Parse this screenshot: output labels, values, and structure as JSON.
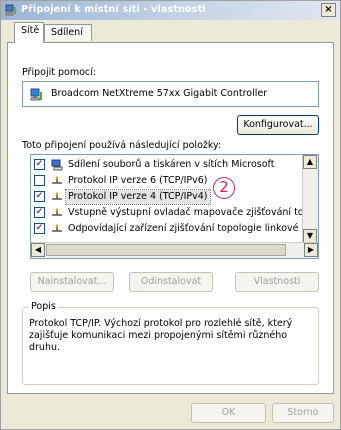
{
  "window": {
    "title": "Připojení k místní síti - vlastnosti",
    "close_glyph": "×",
    "title_icon": "network-connection-icon"
  },
  "tabs": [
    {
      "label": "Sítě",
      "active": true
    },
    {
      "label": "Sdílení",
      "active": false
    }
  ],
  "connect_using": {
    "label": "Připojit pomocí:",
    "adapter_name": "Broadcom NetXtreme 57xx Gigabit Controller",
    "adapter_icon": "network-adapter-icon",
    "configure_button": "Konfigurovat..."
  },
  "components": {
    "label": "Toto připojení používá následující položky:",
    "items": [
      {
        "label": "Sdílení souborů a tiskáren v sítích Microsoft",
        "checked": true,
        "icon": "file-printer-sharing-icon",
        "selected": false
      },
      {
        "label": "Protokol IP verze 6 (TCP/IPv6)",
        "checked": false,
        "icon": "protocol-icon",
        "selected": false
      },
      {
        "label": "Protokol IP verze 4 (TCP/IPv4)",
        "checked": true,
        "icon": "protocol-icon",
        "selected": true
      },
      {
        "label": "Vstupně výstupní ovladač mapovače zjišťování topolo",
        "checked": true,
        "icon": "protocol-icon",
        "selected": false
      },
      {
        "label": "Odpovídající zařízení zjišťování topologie linkové vrstv",
        "checked": true,
        "icon": "protocol-icon",
        "selected": false
      }
    ]
  },
  "actions": {
    "install": "Nainstalovat...",
    "uninstall": "Odinstalovat",
    "properties": "Vlastnosti"
  },
  "description": {
    "legend": "Popis",
    "text": "Protokol TCP/IP. Výchozí protokol pro rozlehlé sítě, který zajišťuje komunikaci mezi propojenými sítěmi různého druhu."
  },
  "footer": {
    "ok": "OK",
    "cancel": "Storno"
  },
  "annotation": {
    "step": "2",
    "color": "#d0206a"
  },
  "colors": {
    "titlebar": "#9bb4d6",
    "dialog_bg": "#ece9d8",
    "border": "#7f9db9"
  }
}
